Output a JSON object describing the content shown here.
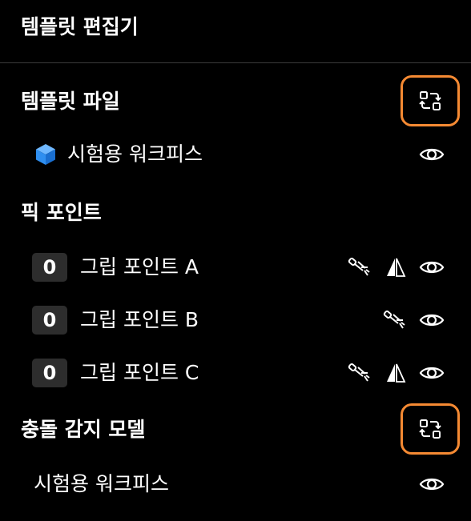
{
  "header": {
    "title": "템플릿 편집기"
  },
  "template_file": {
    "title": "템플릿 파일",
    "item_label": "시험용 워크피스"
  },
  "pick_points": {
    "title": "픽 포인트",
    "items": [
      {
        "count": "0",
        "label": "그립 포인트 A",
        "icons": [
          "gripper-icon",
          "mirror-icon",
          "eye-icon"
        ]
      },
      {
        "count": "0",
        "label": "그립 포인트 B",
        "icons": [
          "gripper-icon",
          "eye-icon"
        ]
      },
      {
        "count": "0",
        "label": "그립 포인트 C",
        "icons": [
          "gripper-icon",
          "mirror-icon",
          "eye-icon"
        ]
      }
    ]
  },
  "collision_model": {
    "title": "충돌 감지 모델",
    "item_label": "시험용 워크피스"
  },
  "colors": {
    "accent": "#f58a33",
    "cube": "#2f8ff0",
    "badge_bg": "#2d2d2d"
  }
}
